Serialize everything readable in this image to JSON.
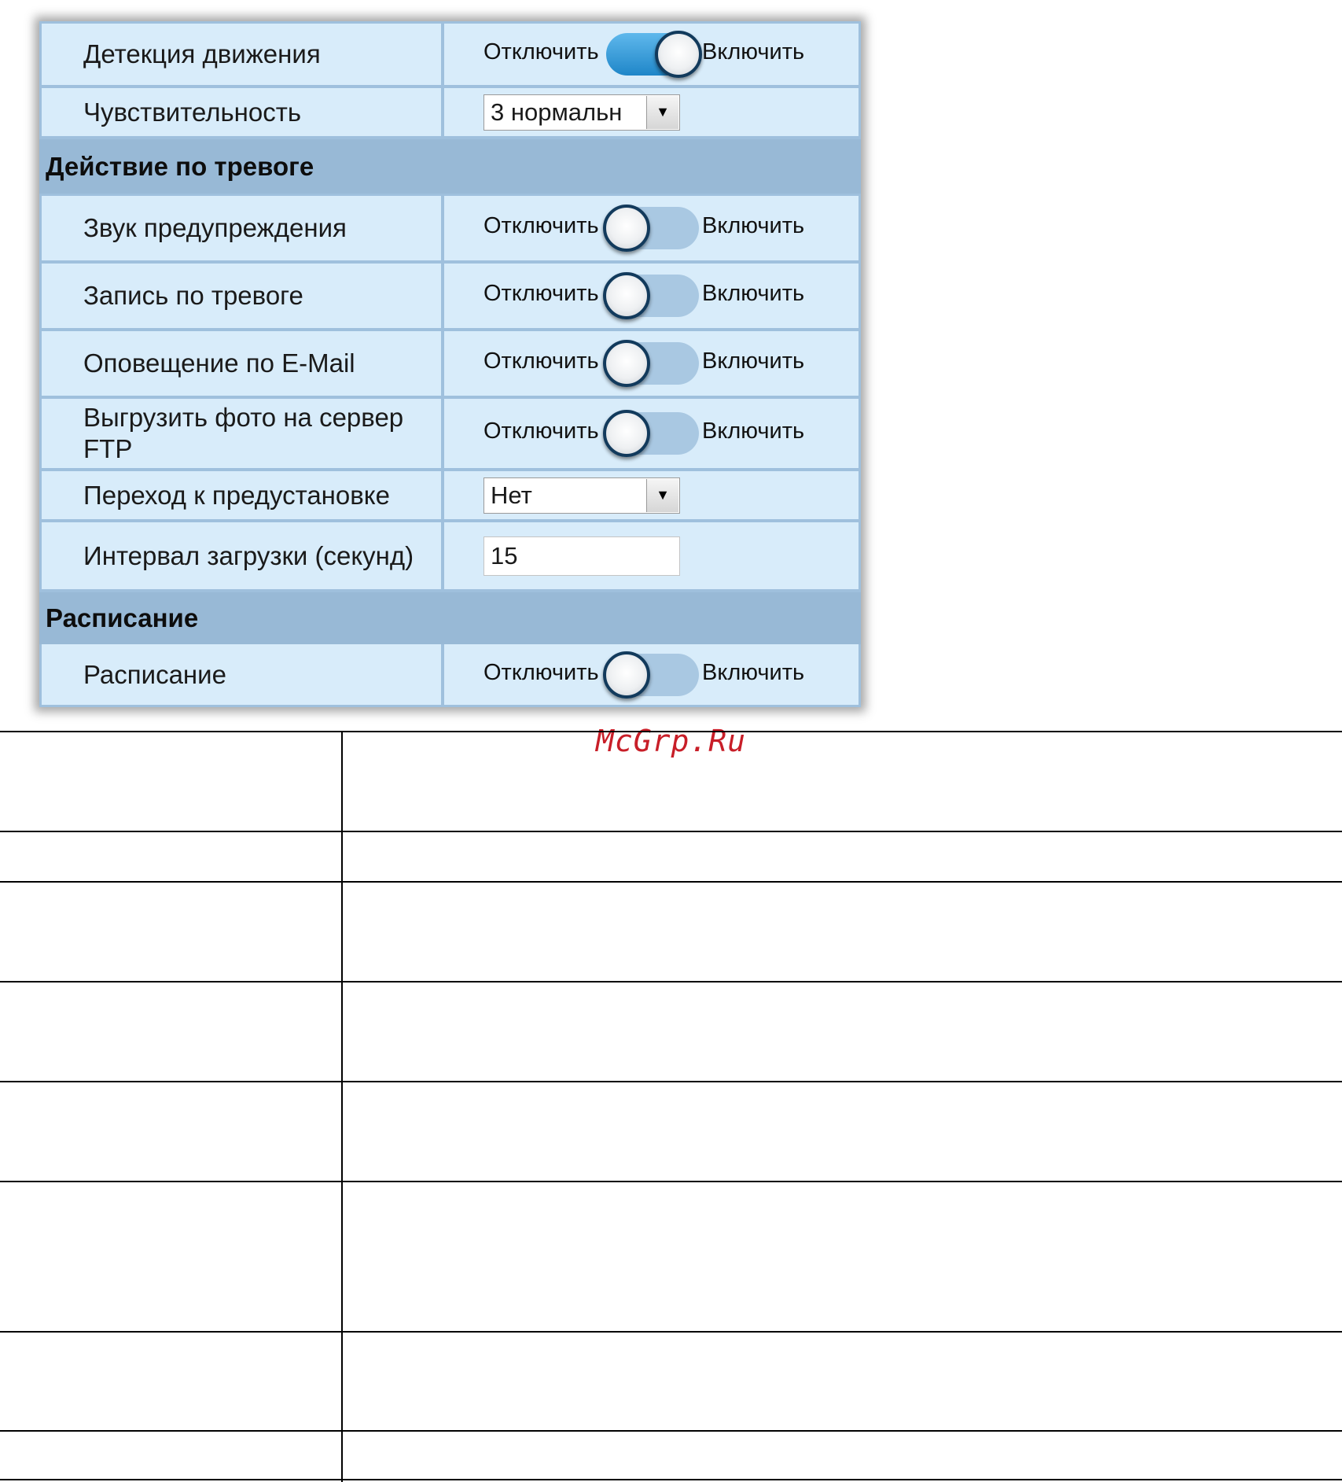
{
  "panel": {
    "rows": [
      {
        "type": "setting",
        "label": "Детекция движения",
        "control": "toggle",
        "state": "on",
        "off_label": "Отключить",
        "on_label": "Включить"
      },
      {
        "type": "setting",
        "label": "Чувствительность",
        "control": "select",
        "value": "3 нормальн"
      },
      {
        "type": "section",
        "title": "Действие по тревоге"
      },
      {
        "type": "setting",
        "label": "Звук предупреждения",
        "control": "toggle",
        "state": "off",
        "off_label": "Отключить",
        "on_label": "Включить"
      },
      {
        "type": "setting",
        "label": "Запись по тревоге",
        "control": "toggle",
        "state": "off",
        "off_label": "Отключить",
        "on_label": "Включить"
      },
      {
        "type": "setting",
        "label": "Оповещение по E-Mail",
        "control": "toggle",
        "state": "off",
        "off_label": "Отключить",
        "on_label": "Включить"
      },
      {
        "type": "setting",
        "label": "Выгрузить фото на сервер FTP",
        "control": "toggle",
        "state": "off",
        "off_label": "Отключить",
        "on_label": "Включить"
      },
      {
        "type": "setting",
        "label": "Переход к предустановке",
        "control": "select",
        "value": "Нет"
      },
      {
        "type": "setting",
        "label": "Интервал загрузки (секунд)",
        "control": "text",
        "value": "15"
      },
      {
        "type": "section",
        "title": "Расписание"
      },
      {
        "type": "setting",
        "label": "Расписание",
        "control": "toggle",
        "state": "off",
        "off_label": "Отключить",
        "on_label": "Включить"
      }
    ]
  },
  "watermark": "McGrp.Ru",
  "colors": {
    "cell_background": "#d8ecfa",
    "section_background": "#98b9d6",
    "toggle_on": "#1f86c8",
    "toggle_off": "#a9c8e2",
    "watermark": "#c81e28"
  }
}
